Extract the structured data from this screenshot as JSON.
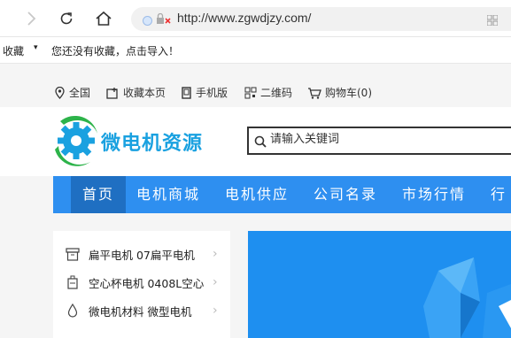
{
  "browser": {
    "url": "http://www.zgwdjzy.com/"
  },
  "favorites": {
    "label": "收藏",
    "message": "您还没有收藏，点击导入！"
  },
  "topbar": {
    "items": [
      {
        "label": "全国",
        "icon": "location-pin-icon"
      },
      {
        "label": "收藏本页",
        "icon": "bookmark-add-icon"
      },
      {
        "label": "手机版",
        "icon": "mobile-icon"
      },
      {
        "label": "二维码",
        "icon": "qrcode-icon"
      },
      {
        "label": "购物车(0)",
        "icon": "cart-icon"
      }
    ]
  },
  "header": {
    "logo_text": "微电机资源",
    "search_placeholder": "请输入关键词"
  },
  "nav": {
    "items": [
      "首页",
      "电机商城",
      "电机供应",
      "公司名录",
      "市场行情",
      "行业"
    ]
  },
  "categories": [
    {
      "label": "扁平电机 07扁平电机",
      "icon": "box-icon"
    },
    {
      "label": "空心杯电机 0408L空心",
      "icon": "bottle-icon"
    },
    {
      "label": "微电机材料 微型电机",
      "icon": "droplet-icon"
    }
  ],
  "colors": {
    "nav_bg": "#2e8ff0",
    "nav_active": "#1f6fc2",
    "logo": "#1aa1e0",
    "logo_gear": "#1aa1e0",
    "logo_swoosh": "#2db34a"
  }
}
